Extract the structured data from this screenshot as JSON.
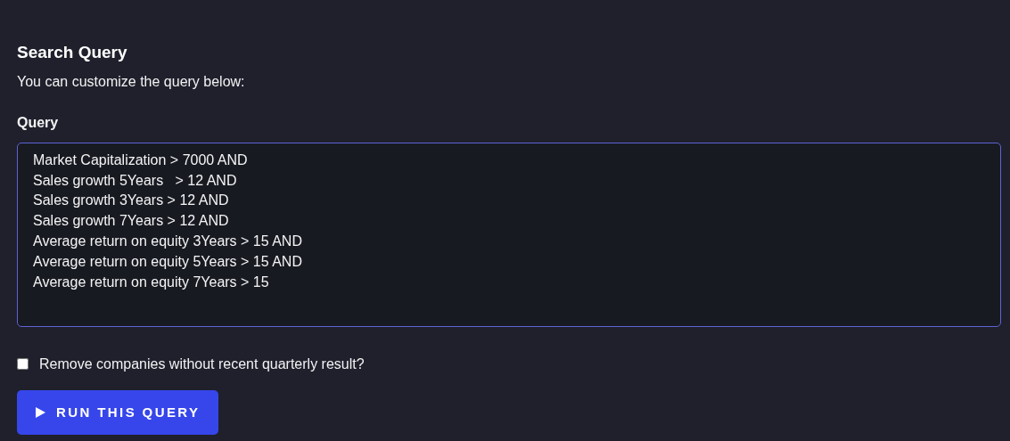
{
  "heading": "Search Query",
  "intro": "You can customize the query below:",
  "query": {
    "label": "Query",
    "lines": [
      "Market Capitalization > 7000 AND",
      "Sales growth 5Years   > 12 AND",
      "Sales growth 3Years > 12 AND",
      "Sales growth 7Years > 12 AND",
      "Average return on equity 3Years > 15 AND",
      "Average return on equity 5Years > 15 AND",
      "Average return on equity 7Years > 15"
    ]
  },
  "filter": {
    "label": "Remove companies without recent quarterly result?",
    "checked": false
  },
  "run_button": {
    "label": "RUN THIS QUERY"
  }
}
